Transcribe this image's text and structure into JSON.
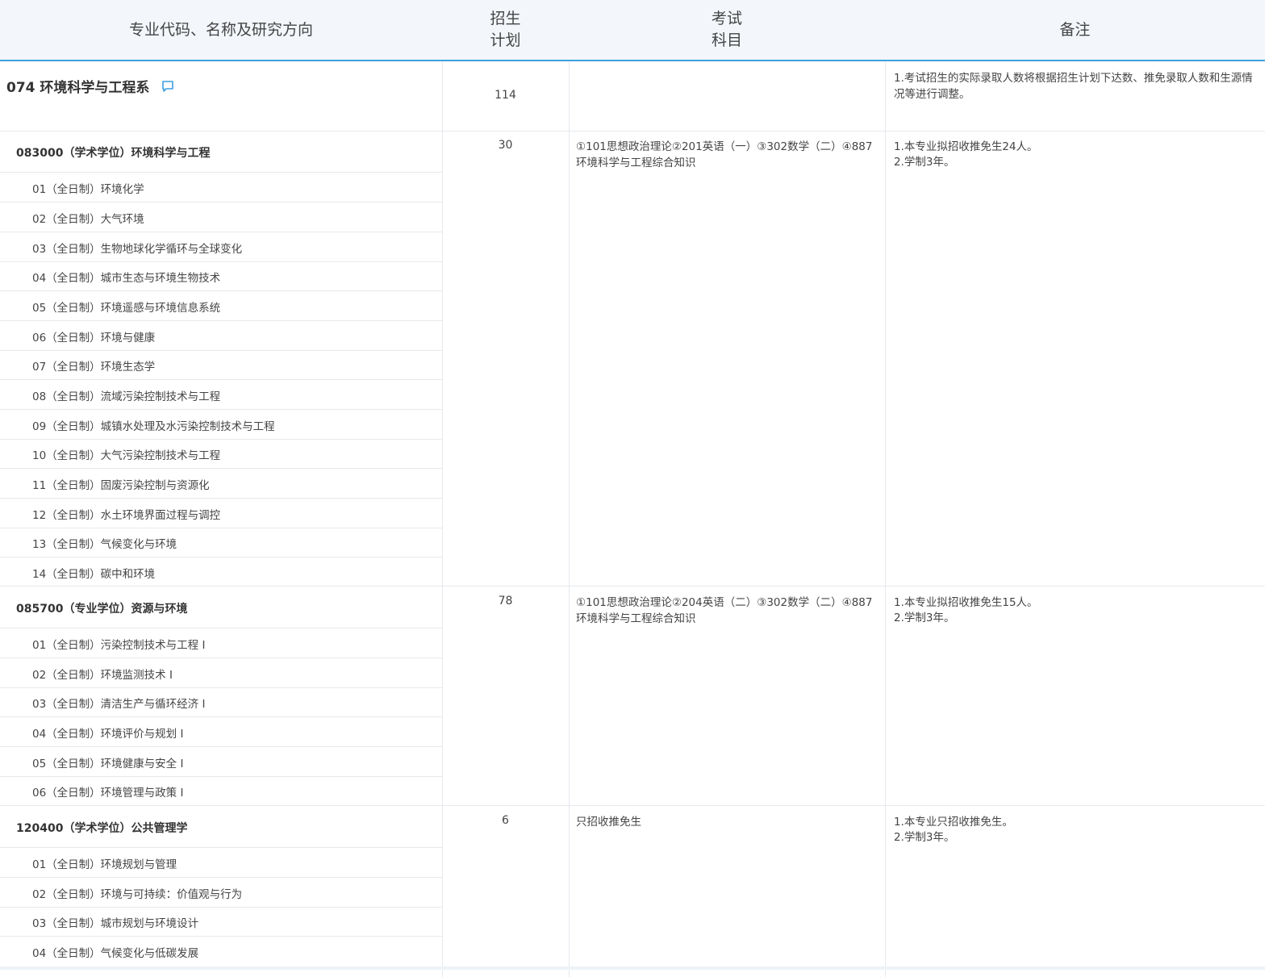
{
  "header": {
    "col1": "专业代码、名称及研究方向",
    "col2_line1": "招生",
    "col2_line2": "计划",
    "col3_line1": "考试",
    "col3_line2": "科目",
    "col4": "备注"
  },
  "department": {
    "title": "074 环境科学与工程系",
    "icon": "comment-icon",
    "plan": "114",
    "note": "1.考试招生的实际录取人数将根据招生计划下达数、推免录取人数和生源情况等进行调整。"
  },
  "programs": [
    {
      "title": "083000（学术学位）环境科学与工程",
      "plan": "30",
      "exam": "①101思想政治理论②201英语（一）③302数学（二）④887环境科学与工程综合知识",
      "note_line1": "1.本专业拟招收推免生24人。",
      "note_line2": "2.学制3年。",
      "directions": [
        "01（全日制）环境化学",
        "02（全日制）大气环境",
        "03（全日制）生物地球化学循环与全球变化",
        "04（全日制）城市生态与环境生物技术",
        "05（全日制）环境遥感与环境信息系统",
        "06（全日制）环境与健康",
        "07（全日制）环境生态学",
        "08（全日制）流域污染控制技术与工程",
        "09（全日制）城镇水处理及水污染控制技术与工程",
        "10（全日制）大气污染控制技术与工程",
        "11（全日制）固废污染控制与资源化",
        "12（全日制）水土环境界面过程与调控",
        "13（全日制）气候变化与环境",
        "14（全日制）碳中和环境"
      ]
    },
    {
      "title": "085700（专业学位）资源与环境",
      "plan": "78",
      "exam": "①101思想政治理论②204英语（二）③302数学（二）④887环境科学与工程综合知识",
      "note_line1": "1.本专业拟招收推免生15人。",
      "note_line2": "2.学制3年。",
      "directions": [
        "01（全日制）污染控制技术与工程 I",
        "02（全日制）环境监测技术 I",
        "03（全日制）清洁生产与循环经济 I",
        "04（全日制）环境评价与规划 I",
        "05（全日制）环境健康与安全 I",
        "06（全日制）环境管理与政策 I"
      ]
    },
    {
      "title": "120400（学术学位）公共管理学",
      "plan": "6",
      "exam": "只招收推免生",
      "note_line1": "1.本专业只招收推免生。",
      "note_line2": "2.学制3年。",
      "directions": [
        "01（全日制）环境规划与管理",
        "02（全日制）环境与可持续：价值观与行为",
        "03（全日制）城市规划与环境设计",
        "04（全日制）气候变化与低碳发展"
      ]
    }
  ]
}
